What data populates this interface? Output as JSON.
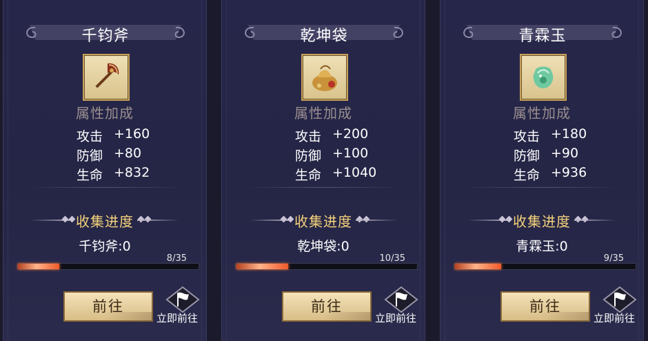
{
  "colors": {
    "bg": "#1b1a2c",
    "title": "#ffffff",
    "collect_title": "#f3d27a",
    "attr_header": "#9a8f8f",
    "button_bg": "#e6d0a0"
  },
  "cards": [
    {
      "title": "千钧斧",
      "icon": "axe-icon",
      "attr_header": "属性加成",
      "stats": [
        {
          "label": "攻击",
          "value": "+160"
        },
        {
          "label": "防御",
          "value": "+80"
        },
        {
          "label": "生命",
          "value": "+832"
        }
      ],
      "collect_title": "收集进度",
      "collect_name": "千钧斧:0",
      "progress_text": "8/35",
      "progress_current": 8,
      "progress_total": 35,
      "goto_label": "前往",
      "instant_label": "立即前往"
    },
    {
      "title": "乾坤袋",
      "icon": "treasure-bag-icon",
      "attr_header": "属性加成",
      "stats": [
        {
          "label": "攻击",
          "value": "+200"
        },
        {
          "label": "防御",
          "value": "+100"
        },
        {
          "label": "生命",
          "value": "+1040"
        }
      ],
      "collect_title": "收集进度",
      "collect_name": "乾坤袋:0",
      "progress_text": "10/35",
      "progress_current": 10,
      "progress_total": 35,
      "goto_label": "前往",
      "instant_label": "立即前往"
    },
    {
      "title": "青霖玉",
      "icon": "jade-icon",
      "attr_header": "属性加成",
      "stats": [
        {
          "label": "攻击",
          "value": "+180"
        },
        {
          "label": "防御",
          "value": "+90"
        },
        {
          "label": "生命",
          "value": "+936"
        }
      ],
      "collect_title": "收集进度",
      "collect_name": "青霖玉:0",
      "progress_text": "9/35",
      "progress_current": 9,
      "progress_total": 35,
      "goto_label": "前往",
      "instant_label": "立即前往"
    }
  ]
}
